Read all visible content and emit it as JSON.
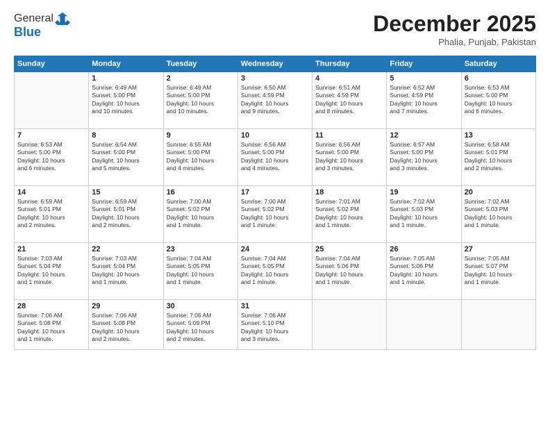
{
  "header": {
    "logo_general": "General",
    "logo_blue": "Blue",
    "month": "December 2025",
    "location": "Phalia, Punjab, Pakistan"
  },
  "weekdays": [
    "Sunday",
    "Monday",
    "Tuesday",
    "Wednesday",
    "Thursday",
    "Friday",
    "Saturday"
  ],
  "weeks": [
    [
      {
        "day": "",
        "info": ""
      },
      {
        "day": "1",
        "info": "Sunrise: 6:49 AM\nSunset: 5:00 PM\nDaylight: 10 hours\nand 10 minutes."
      },
      {
        "day": "2",
        "info": "Sunrise: 6:49 AM\nSunset: 5:00 PM\nDaylight: 10 hours\nand 10 minutes."
      },
      {
        "day": "3",
        "info": "Sunrise: 6:50 AM\nSunset: 4:59 PM\nDaylight: 10 hours\nand 9 minutes."
      },
      {
        "day": "4",
        "info": "Sunrise: 6:51 AM\nSunset: 4:59 PM\nDaylight: 10 hours\nand 8 minutes."
      },
      {
        "day": "5",
        "info": "Sunrise: 6:52 AM\nSunset: 4:59 PM\nDaylight: 10 hours\nand 7 minutes."
      },
      {
        "day": "6",
        "info": "Sunrise: 6:53 AM\nSunset: 5:00 PM\nDaylight: 10 hours\nand 6 minutes."
      }
    ],
    [
      {
        "day": "7",
        "info": "Sunrise: 6:53 AM\nSunset: 5:00 PM\nDaylight: 10 hours\nand 6 minutes."
      },
      {
        "day": "8",
        "info": "Sunrise: 6:54 AM\nSunset: 5:00 PM\nDaylight: 10 hours\nand 5 minutes."
      },
      {
        "day": "9",
        "info": "Sunrise: 6:55 AM\nSunset: 5:00 PM\nDaylight: 10 hours\nand 4 minutes."
      },
      {
        "day": "10",
        "info": "Sunrise: 6:56 AM\nSunset: 5:00 PM\nDaylight: 10 hours\nand 4 minutes."
      },
      {
        "day": "11",
        "info": "Sunrise: 6:56 AM\nSunset: 5:00 PM\nDaylight: 10 hours\nand 3 minutes."
      },
      {
        "day": "12",
        "info": "Sunrise: 6:57 AM\nSunset: 5:00 PM\nDaylight: 10 hours\nand 3 minutes."
      },
      {
        "day": "13",
        "info": "Sunrise: 6:58 AM\nSunset: 5:01 PM\nDaylight: 10 hours\nand 2 minutes."
      }
    ],
    [
      {
        "day": "14",
        "info": "Sunrise: 6:59 AM\nSunset: 5:01 PM\nDaylight: 10 hours\nand 2 minutes."
      },
      {
        "day": "15",
        "info": "Sunrise: 6:59 AM\nSunset: 5:01 PM\nDaylight: 10 hours\nand 2 minutes."
      },
      {
        "day": "16",
        "info": "Sunrise: 7:00 AM\nSunset: 5:02 PM\nDaylight: 10 hours\nand 1 minute."
      },
      {
        "day": "17",
        "info": "Sunrise: 7:00 AM\nSunset: 5:02 PM\nDaylight: 10 hours\nand 1 minute."
      },
      {
        "day": "18",
        "info": "Sunrise: 7:01 AM\nSunset: 5:02 PM\nDaylight: 10 hours\nand 1 minute."
      },
      {
        "day": "19",
        "info": "Sunrise: 7:02 AM\nSunset: 5:03 PM\nDaylight: 10 hours\nand 1 minute."
      },
      {
        "day": "20",
        "info": "Sunrise: 7:02 AM\nSunset: 5:03 PM\nDaylight: 10 hours\nand 1 minute."
      }
    ],
    [
      {
        "day": "21",
        "info": "Sunrise: 7:03 AM\nSunset: 5:04 PM\nDaylight: 10 hours\nand 1 minute."
      },
      {
        "day": "22",
        "info": "Sunrise: 7:03 AM\nSunset: 5:04 PM\nDaylight: 10 hours\nand 1 minute."
      },
      {
        "day": "23",
        "info": "Sunrise: 7:04 AM\nSunset: 5:05 PM\nDaylight: 10 hours\nand 1 minute."
      },
      {
        "day": "24",
        "info": "Sunrise: 7:04 AM\nSunset: 5:05 PM\nDaylight: 10 hours\nand 1 minute."
      },
      {
        "day": "25",
        "info": "Sunrise: 7:04 AM\nSunset: 5:06 PM\nDaylight: 10 hours\nand 1 minute."
      },
      {
        "day": "26",
        "info": "Sunrise: 7:05 AM\nSunset: 5:06 PM\nDaylight: 10 hours\nand 1 minute."
      },
      {
        "day": "27",
        "info": "Sunrise: 7:05 AM\nSunset: 5:07 PM\nDaylight: 10 hours\nand 1 minute."
      }
    ],
    [
      {
        "day": "28",
        "info": "Sunrise: 7:06 AM\nSunset: 5:08 PM\nDaylight: 10 hours\nand 1 minute."
      },
      {
        "day": "29",
        "info": "Sunrise: 7:06 AM\nSunset: 5:08 PM\nDaylight: 10 hours\nand 2 minutes."
      },
      {
        "day": "30",
        "info": "Sunrise: 7:06 AM\nSunset: 5:09 PM\nDaylight: 10 hours\nand 2 minutes."
      },
      {
        "day": "31",
        "info": "Sunrise: 7:06 AM\nSunset: 5:10 PM\nDaylight: 10 hours\nand 3 minutes."
      },
      {
        "day": "",
        "info": ""
      },
      {
        "day": "",
        "info": ""
      },
      {
        "day": "",
        "info": ""
      }
    ]
  ]
}
